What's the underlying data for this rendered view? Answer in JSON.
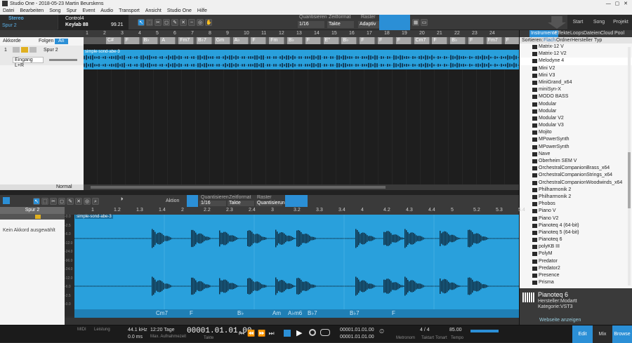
{
  "window": {
    "title": "Studio One - 2018-05-23 Martin Beurskens"
  },
  "menu": [
    "Datei",
    "Bearbeiten",
    "Song",
    "Spur",
    "Event",
    "Audio",
    "Transport",
    "Ansicht",
    "Studio One",
    "Hilfe"
  ],
  "topbar": {
    "io_label": "Stereo",
    "track_sel": "Spur 2",
    "device": "Control4",
    "device_sub": "Keylab 88",
    "meter": "99.21",
    "quantize_label": "Quantisieren",
    "quantize_val": "1/16",
    "timeformat_label": "Zeitformat",
    "timeformat_val": "Takte",
    "raster_label": "Raster",
    "raster_val": "Adaptiv",
    "start": "Start",
    "song": "Song",
    "project": "Projekt"
  },
  "trackhead": {
    "chords_label": "Akkorde",
    "follow_label": "Folgen",
    "follow_state": "An",
    "track_number": "1",
    "track_name": "Spur 2",
    "input": "Eingang L+R",
    "mode": "Normal"
  },
  "arranger": {
    "ruler": [
      "1",
      "2",
      "3",
      "4",
      "5",
      "6",
      "7",
      "8",
      "9",
      "10",
      "11",
      "12",
      "13",
      "14",
      "15",
      "16",
      "17",
      "18",
      "19",
      "20",
      "21",
      "22",
      "23",
      "24"
    ],
    "chords": [
      "C#",
      "F",
      "B♭",
      "A",
      "Fm7",
      "B♭7",
      "Gm",
      "A♭",
      "F",
      "Fm",
      "B♭",
      "F",
      "E°",
      "B♭",
      "F",
      "F",
      "F",
      "Cm7",
      "F",
      "B♭",
      "F",
      "Fm7",
      "F",
      "B♭"
    ],
    "event_name": "simple-sond-abe-3"
  },
  "browser": {
    "tabs": [
      "Instrumente",
      "Effekte",
      "Loops",
      "Dateien",
      "Cloud",
      "Pool"
    ],
    "sort_label": "Sortieren:",
    "sort_options": [
      "Flach",
      "Ordner",
      "Hersteller",
      "Typ"
    ],
    "items": [
      "Matrix-12 V",
      "Matrix-12 V2",
      "Melodyne 4",
      "Mini V2",
      "Mini V3",
      "MiniGrand_x64",
      "miniSyn-X",
      "MODO BASS",
      "Modular",
      "Modular",
      "Modular V2",
      "Modular V3",
      "Mojito",
      "MPowerSynth",
      "MPowerSynth",
      "Nave",
      "Oberheim SEM V",
      "OrchestralCompanionBrass_x64",
      "OrchestralCompanionStrings_x64",
      "OrchestralCompanionWoodwinds_x64",
      "Philharmonik 2",
      "Philharmonik 2",
      "Phobos",
      "Piano V",
      "Piano V2",
      "Pianoteq 4 (64-bit)",
      "Pianoteq 5 (64-bit)",
      "Pianoteq 6",
      "polyKB III",
      "PolyM",
      "Predator",
      "Predator2",
      "Presence",
      "Prisma"
    ],
    "selected_name": "Pianoteq 6",
    "vendor_label": "Hersteller:",
    "vendor": "Modartt",
    "category_label": "Kategorie:",
    "category": "VST3",
    "show_web": "Webseite anzeigen"
  },
  "editor": {
    "track": "Spur 2",
    "no_chord": "Kein Akkord ausgewählt",
    "action": "Aktion",
    "quantize_label": "Quantisieren",
    "quantize_val": "1/16",
    "timeformat_label": "Zeitformat",
    "timeformat_val": "Takte",
    "raster_label": "Raster",
    "raster_val": "Quantisierung",
    "ruler": [
      "1",
      "1.2",
      "1.3",
      "1.4",
      "2",
      "2.2",
      "2.3",
      "2.4",
      "3",
      "3.2",
      "3.3",
      "3.4",
      "4",
      "4.2",
      "4.3",
      "4.4",
      "5",
      "5.2",
      "5.3",
      "5.4"
    ],
    "chords": [
      "Cm7",
      "F",
      "B♭",
      "Am",
      "A♭m6",
      "B♭7",
      "B♭7",
      "F"
    ],
    "event_name": "simple-sond-abe-3",
    "db_labels": [
      "-0.0",
      "-2.5",
      "-6.0",
      "-12.0",
      "-24.0",
      "-96.0",
      "-24.0",
      "-12.0",
      "-6.0",
      "-2.5",
      "-0.0"
    ]
  },
  "transport": {
    "midi": "MIDI",
    "load": "Leistung",
    "rate": "44.1 kHz",
    "latency": "0.0 ms",
    "days": "12:20 Tage",
    "rec_max": "Max. Aufnahmezeit",
    "position": "00001.01.01.00",
    "pos_label": "Takte",
    "loop_start": "00001.01.01.00",
    "loop_end": "00001.01.01.00",
    "metronome": "Metronom",
    "timesig": "4 / 4",
    "timesig_label": "Taktart",
    "key_label": "Tonart",
    "tempo": "85.00",
    "tempo_label": "Tempo",
    "edit": "Edit",
    "mix": "Mix",
    "browse": "Browse"
  }
}
